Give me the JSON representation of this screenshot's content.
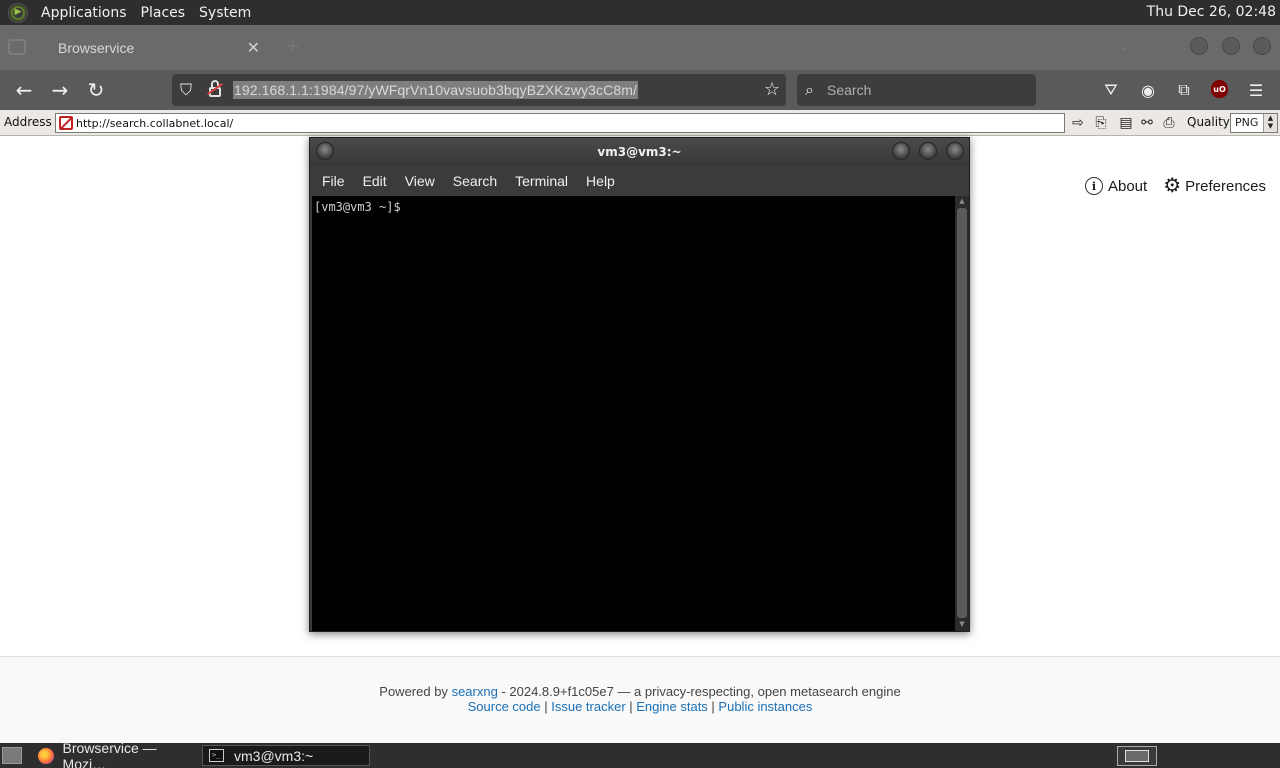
{
  "top_panel": {
    "menus": [
      "Applications",
      "Places",
      "System"
    ],
    "clock": "Thu Dec 26, 02:48"
  },
  "browser": {
    "tab_title": "Browservice",
    "url": "192.168.1.1:1984/97/yWFqrVn10vavsuob3bqyBZXKzwy3cC8m/",
    "search_placeholder": "Search",
    "ublock_label": "uO"
  },
  "browservice_toolbar": {
    "address_label": "Address",
    "address_value": "http://search.collabnet.local/",
    "quality_label": "Quality",
    "quality_value": "PNG"
  },
  "page": {
    "nav": {
      "about": "About",
      "preferences": "Preferences"
    },
    "footer": {
      "powered_by": "Powered by",
      "engine_link": "searxng",
      "version_text": "- 2024.8.9+f1c05e7 — a privacy-respecting, open metasearch engine",
      "links": [
        "Source code",
        "Issue tracker",
        "Engine stats",
        "Public instances"
      ],
      "separator": " | "
    }
  },
  "terminal": {
    "title": "vm3@vm3:~",
    "menus": [
      "File",
      "Edit",
      "View",
      "Search",
      "Terminal",
      "Help"
    ],
    "prompt": "[vm3@vm3 ~]$"
  },
  "taskbar": {
    "tasks": [
      {
        "label": "Browservice — Mozi…",
        "icon": "firefox-icon"
      },
      {
        "label": "vm3@vm3:~",
        "icon": "terminal-icon"
      }
    ]
  },
  "colors": {
    "panel_bg": "#2e2e2e",
    "link": "#1a6fb5",
    "terminal_bg": "#000000"
  }
}
